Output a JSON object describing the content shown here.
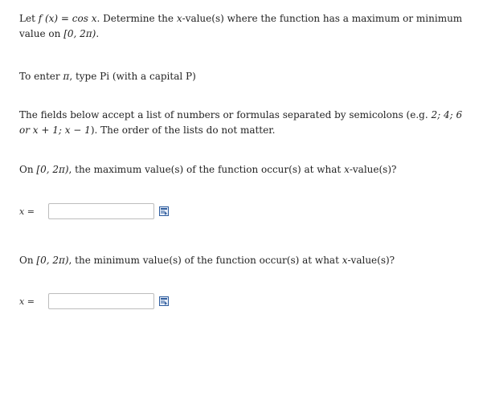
{
  "question": {
    "intro_part1": "Let ",
    "intro_func": "f (x) = cos x",
    "intro_part2": ". Determine the ",
    "intro_var": "x",
    "intro_part3": "-value(s) where the function has a maximum or minimum value on ",
    "intro_interval": "[0, 2π)",
    "intro_end": "."
  },
  "pi_hint": {
    "part1": "To enter ",
    "pi_symbol": "π",
    "part2": ", type Pi (with a capital P)"
  },
  "list_hint": {
    "part1": "The fields below accept a list of numbers or formulas separated by semicolons (e.g. ",
    "example": "2; 4; 6 or x + 1; x − 1",
    "part2": "). The order of the lists do not matter."
  },
  "max_question": {
    "part1": "On ",
    "interval": "[0, 2π)",
    "part2": ", the maximum value(s) of the function occur(s) at what ",
    "var": "x",
    "part3": "-value(s)?"
  },
  "min_question": {
    "part1": "On ",
    "interval": "[0, 2π)",
    "part2": ", the minimum value(s) of the function occur(s) at what ",
    "var": "x",
    "part3": "-value(s)?"
  },
  "answer_label": "x =",
  "max_answer": {
    "value": "",
    "placeholder": ""
  },
  "min_answer": {
    "value": "",
    "placeholder": ""
  },
  "icons": {
    "preview": "preview-icon"
  },
  "colors": {
    "text": "#222222",
    "input_border": "#bdbdbd",
    "icon_blue": "#2f5d9e"
  }
}
